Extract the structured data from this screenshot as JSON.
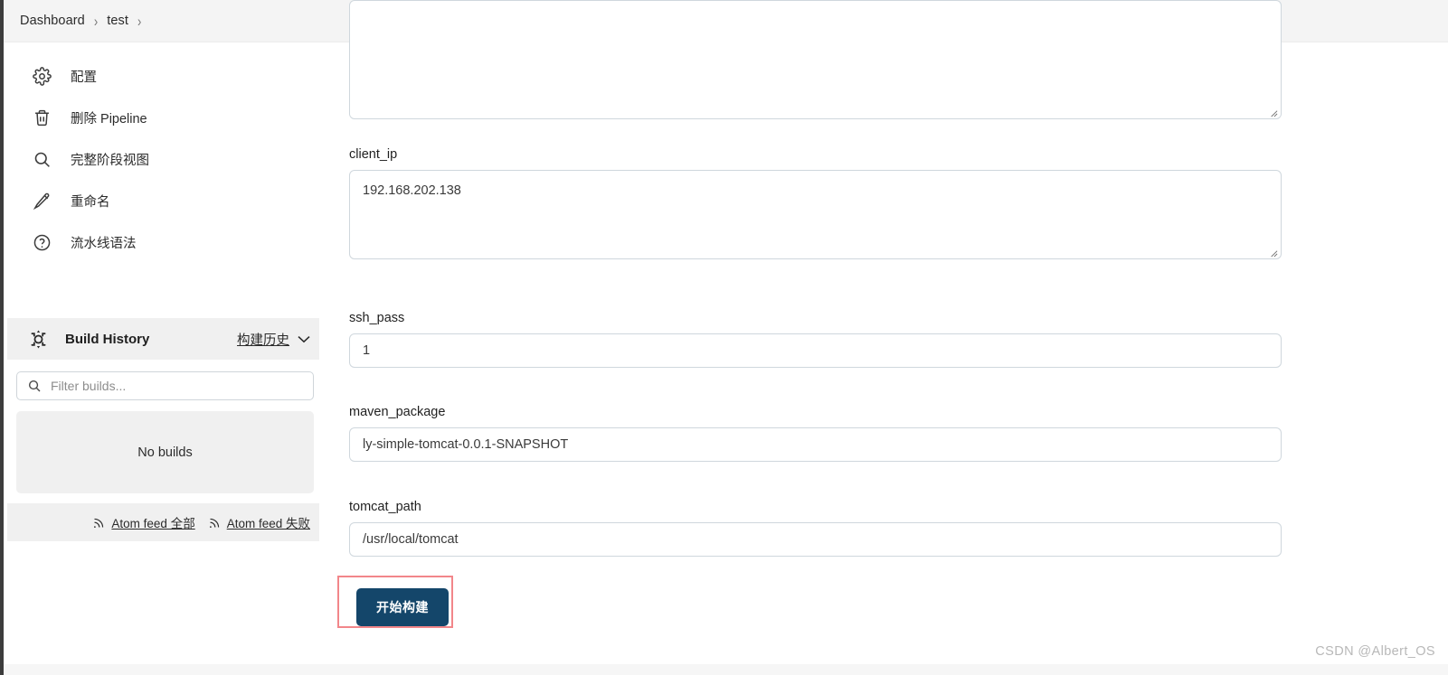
{
  "breadcrumb": {
    "items": [
      {
        "label": "Dashboard",
        "icon": "none"
      },
      {
        "label": "test",
        "icon": "none"
      }
    ],
    "separator": "›"
  },
  "sidebar": {
    "items": [
      {
        "label": "配置",
        "icon": "gear-icon"
      },
      {
        "label": "删除 Pipeline",
        "icon": "trash-icon"
      },
      {
        "label": "完整阶段视图",
        "icon": "search-icon"
      },
      {
        "label": "重命名",
        "icon": "pencil-icon"
      },
      {
        "label": "流水线语法",
        "icon": "question-circle-icon"
      }
    ],
    "build_history": {
      "title": "Build History",
      "icon": "build-history-icon",
      "link_label": "构建历史",
      "chevron": "chevron-down-icon",
      "filter_placeholder": "Filter builds...",
      "filter_value": "",
      "filter_icon": "search-icon",
      "empty_message": "No builds",
      "feeds": [
        {
          "label": "Atom feed 全部",
          "icon": "rss-icon"
        },
        {
          "label": "Atom feed 失败",
          "icon": "rss-icon"
        }
      ]
    }
  },
  "form": {
    "fields": [
      {
        "name": "top_textarea",
        "label": "",
        "value": "",
        "type": "textarea"
      },
      {
        "name": "client_ip",
        "label": "client_ip",
        "value": "192.168.202.138",
        "type": "textarea"
      },
      {
        "name": "ssh_pass",
        "label": "ssh_pass",
        "value": "1",
        "type": "input"
      },
      {
        "name": "maven_package",
        "label": "maven_package",
        "value": "ly-simple-tomcat-0.0.1-SNAPSHOT",
        "type": "input"
      },
      {
        "name": "tomcat_path",
        "label": "tomcat_path",
        "value": "/usr/local/tomcat",
        "type": "input"
      }
    ],
    "submit_label": "开始构建"
  },
  "colors": {
    "button_bg": "#14466a",
    "annotation": "#f2868a",
    "panel_bg": "#f0f0f0",
    "border": "#cfd7dd"
  },
  "watermark": "CSDN @Albert_OS"
}
